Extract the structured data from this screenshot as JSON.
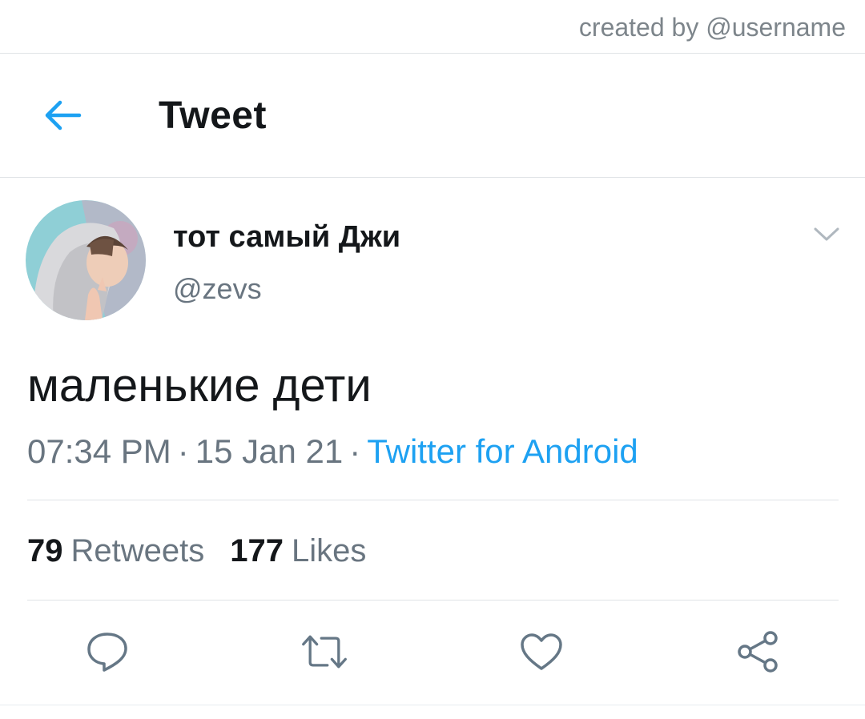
{
  "watermark": {
    "text": "created by @username"
  },
  "header": {
    "title": "Tweet",
    "back_icon": "arrow-left-icon"
  },
  "tweet": {
    "author": {
      "display_name": "тот самый Джи",
      "handle": "@zevs"
    },
    "text": "маленькие дети",
    "time": "07:34 PM",
    "date": "15 Jan 21",
    "separator": "·",
    "source": "Twitter for Android",
    "stats": {
      "retweets_count": "79",
      "retweets_label": "Retweets",
      "likes_count": "177",
      "likes_label": "Likes"
    },
    "actions": [
      "reply-icon",
      "retweet-icon",
      "like-icon",
      "share-icon"
    ]
  },
  "colors": {
    "accent": "#1da1f2",
    "text_primary": "#14171a",
    "text_secondary": "#697580",
    "divider": "#dfe3e6"
  }
}
